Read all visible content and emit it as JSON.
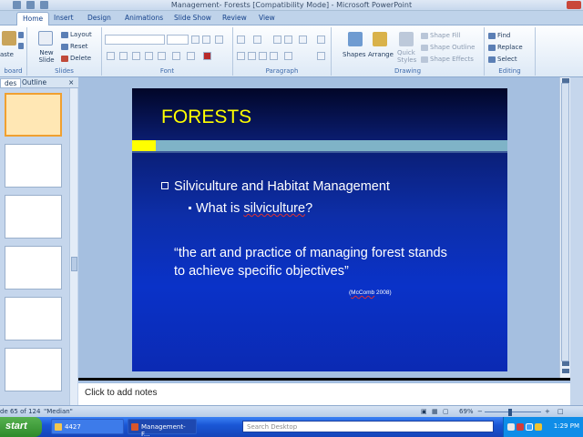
{
  "window": {
    "title": "Management- Forests [Compatibility Mode] - Microsoft PowerPoint"
  },
  "ribbon": {
    "tabs": [
      "Home",
      "Insert",
      "Design",
      "Animations",
      "Slide Show",
      "Review",
      "View"
    ],
    "active_tab": "Home",
    "clipboard": {
      "paste_label": "aste",
      "group_label": "board"
    },
    "slides": {
      "new_slide_label": "New Slide",
      "layout_label": "Layout",
      "reset_label": "Reset",
      "delete_label": "Delete",
      "group_label": "Slides"
    },
    "font": {
      "group_label": "Font"
    },
    "paragraph": {
      "group_label": "Paragraph"
    },
    "drawing": {
      "shapes_label": "Shapes",
      "arrange_label": "Arrange",
      "quick_styles_label": "Quick Styles",
      "shape_fill_label": "Shape Fill",
      "shape_outline_label": "Shape Outline",
      "shape_effects_label": "Shape Effects",
      "group_label": "Drawing"
    },
    "editing": {
      "find_label": "Find",
      "replace_label": "Replace",
      "select_label": "Select",
      "group_label": "Editing"
    }
  },
  "left_panel": {
    "tabs": [
      "des",
      "Outline"
    ],
    "close_label": "×",
    "thumbnail_count": 6,
    "selected_thumbnail": 0
  },
  "slide": {
    "title": "FORESTS",
    "bullet1": "Silviculture and Habitat Management",
    "bullet2_prefix": "What is ",
    "bullet2_word": "silviculture",
    "bullet2_suffix": "?",
    "quote_line1": "“the art and practice of managing forest stands",
    "quote_line2": "to achieve specific objectives”",
    "citation_open": "(",
    "citation_name": "McComb",
    "citation_year": " 2008)",
    "colors": {
      "title": "#ffff00",
      "text": "#ffffff",
      "bar": "#7fb3c7",
      "bar_accent": "#ffff00"
    }
  },
  "notes": {
    "placeholder": "Click to add notes"
  },
  "statusbar": {
    "slide_info": "de 65 of 124",
    "theme": "\"Median\"",
    "zoom": "69%"
  },
  "taskbar": {
    "start_label": "start",
    "tasks": [
      "4427",
      "Management- F..."
    ],
    "search_placeholder": "Search Desktop",
    "clock": "1:29 PM"
  }
}
